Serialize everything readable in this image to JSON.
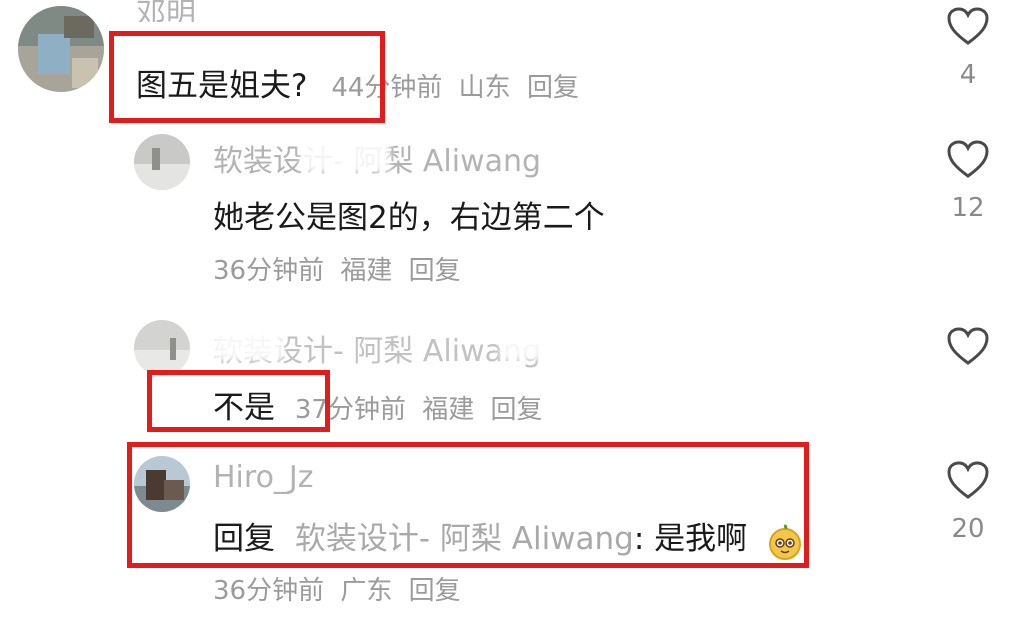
{
  "comments": [
    {
      "author": "邓明",
      "text": "图五是姐夫?",
      "time": "44分钟前",
      "location": "山东",
      "reply_label": "回复",
      "likes": "4"
    },
    {
      "author": "软装设计- 阿梨 Aliwang",
      "text": "她老公是图2的，右边第二个",
      "time": "36分钟前",
      "location": "福建",
      "reply_label": "回复",
      "likes": "12"
    },
    {
      "author": "软装设计- 阿梨 Aliwang",
      "text": "不是",
      "time": "37分钟前",
      "location": "福建",
      "reply_label": "回复",
      "likes": ""
    },
    {
      "author": "Hiro_Jz",
      "reply_prefix": "回复",
      "reply_to": "软装设计- 阿梨 Aliwang",
      "text": ": 是我啊",
      "time": "36分钟前",
      "location": "广东",
      "reply_label": "回复",
      "likes": "20"
    }
  ],
  "icons": {
    "like": "heart-outline-icon",
    "emoji": "mango-face-emoji"
  },
  "colors": {
    "highlight_box": "#e21b1b",
    "author_text": "#b3b3b3",
    "body_text": "#1a1a1a",
    "meta_text": "#9b9b9b"
  }
}
